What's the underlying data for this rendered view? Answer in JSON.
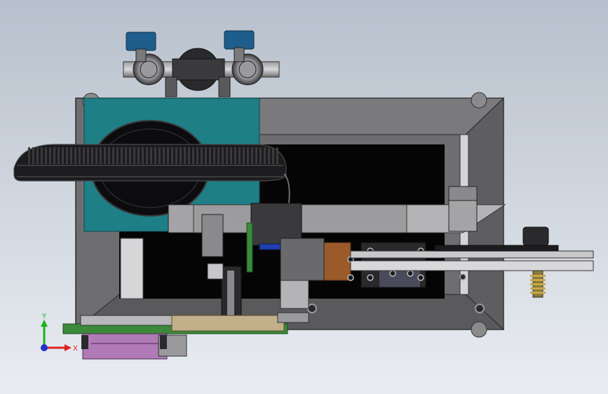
{
  "viewport": {
    "background_top": "#b7c0cc",
    "background_bottom": "#e9edf2"
  },
  "axis_triad": {
    "x_label": "X",
    "y_label": "Y",
    "x_color": "#e02020",
    "y_color": "#19b319",
    "z_color": "#2030c8"
  },
  "colors": {
    "frame": "#6e6e70",
    "frame_dark": "#3c3c3e",
    "teal_panel": "#1e7f86",
    "cavity": "#050505",
    "blue_motor": "#1f5e8c",
    "purple_block": "#b07ab6",
    "green_rail": "#3b8a3b",
    "copper": "#9b5a2a",
    "tan_plate": "#c2b08a"
  },
  "components": [
    "machine-frame",
    "teal-panel",
    "lens-disk",
    "slotted-cover",
    "top-valve-assembly",
    "servo-motor-left",
    "servo-motor-right",
    "center-mechanism",
    "feed-rail",
    "roller-shaft",
    "bottom-plate",
    "purple-block",
    "stepper-motor"
  ]
}
